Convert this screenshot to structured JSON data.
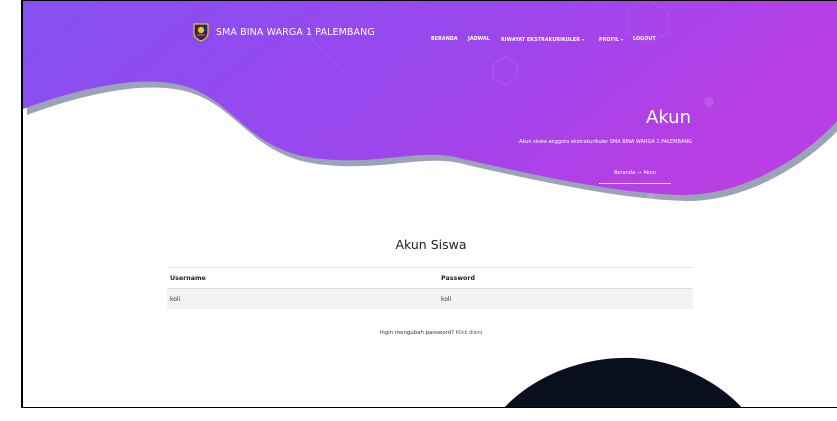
{
  "brand": {
    "name": "SMA BINA WARGA 1 PALEMBANG"
  },
  "nav": {
    "items": [
      {
        "label": "BERANDA"
      },
      {
        "label": "JADWAL"
      },
      {
        "label": "RIWAYAT EKSTRAKURIKULER",
        "dropdown": true
      },
      {
        "label": "PROFIL",
        "dropdown": true
      },
      {
        "label": "LOGOUT"
      }
    ],
    "caret": "▾"
  },
  "hero": {
    "title": "Akun",
    "subtitle": "Akun siswa anggota ekstrakurikuler SMA BINA WARGA 1 PALEMBANG",
    "breadcrumb": {
      "home": "Beranda",
      "arrow": "→",
      "current": "Akun"
    }
  },
  "section": {
    "title": "Akun Siswa"
  },
  "table": {
    "headers": [
      "Username",
      "Password"
    ],
    "rows": [
      [
        "koli",
        "koli"
      ]
    ]
  },
  "footer_prompt": {
    "text": "Ingin mengubah password?",
    "link": "Klick disini"
  },
  "colors": {
    "gradient_start": "#8a52f0",
    "gradient_end": "#b43fe6",
    "dark_blob": "#0a0f1e"
  }
}
